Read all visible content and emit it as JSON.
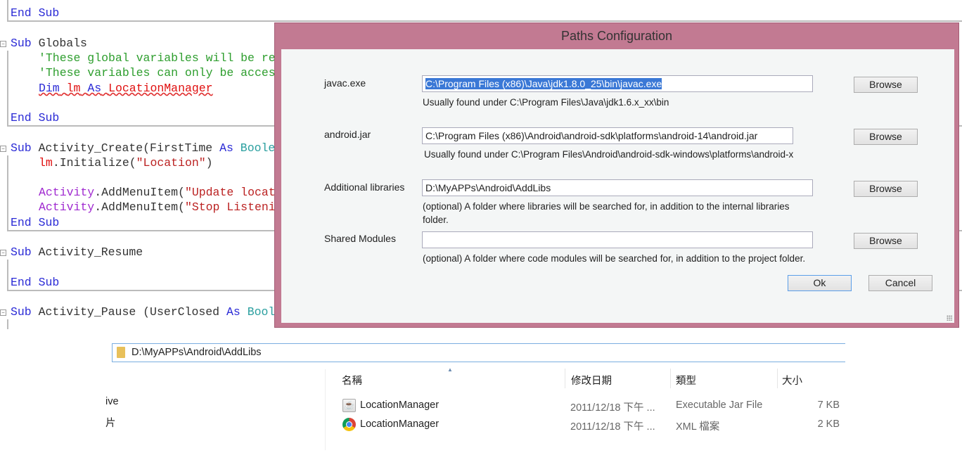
{
  "code": {
    "line0": [
      "End",
      "Sub"
    ],
    "globals": {
      "sub": "Sub",
      "name": "Globals",
      "c1": "'These global variables will be re",
      "c2": "'These variables can only be acces",
      "dim": "Dim",
      "var": "lm",
      "as": "As",
      "type": "LocationManager",
      "end": "End Sub"
    },
    "create": {
      "sub": "Sub",
      "name": "Activity_Create(FirstTime ",
      "as": "As",
      "type": "Boole",
      "l1var": "lm",
      "l1": ".Initialize(",
      "l1str": "\"Location\"",
      "l1end": ")",
      "obj": "Activity",
      "m1": ".AddMenuItem(",
      "s1": "\"Update locat",
      "s2": "\"Stop Listeni",
      "end": "End Sub"
    },
    "resume": {
      "sub": "Sub",
      "name": "Activity_Resume",
      "end": "End Sub"
    },
    "pause": {
      "sub": "Sub",
      "name": "Activity_Pause (UserClosed ",
      "as": "As",
      "type": "Bool"
    }
  },
  "dialog": {
    "title": "Paths Configuration",
    "rows": [
      {
        "label": "javac.exe",
        "value": "C:\\Program Files (x86)\\Java\\jdk1.8.0_25\\bin\\javac.exe",
        "hint": "Usually found under C:\\Program Files\\Java\\jdk1.6.x_xx\\bin",
        "browse": "Browse"
      },
      {
        "label": "android.jar",
        "value": "C:\\Program Files (x86)\\Android\\android-sdk\\platforms\\android-14\\android.jar",
        "hint": "Usually found under C:\\Program Files\\Android\\android-sdk-windows\\platforms\\android-x",
        "browse": "Browse"
      },
      {
        "label": "Additional libraries",
        "value": "D:\\MyAPPs\\Android\\AddLibs",
        "hint": "(optional) A folder where libraries will be searched for, in addition to the internal libraries folder.",
        "browse": "Browse"
      },
      {
        "label": "Shared Modules",
        "value": "",
        "hint": "(optional) A folder where code modules will be searched for, in addition to the project folder.",
        "browse": "Browse"
      }
    ],
    "ok": "Ok",
    "cancel": "Cancel"
  },
  "explorer": {
    "path": "D:\\MyAPPs\\Android\\AddLibs",
    "nav": [
      "ive",
      "片"
    ],
    "columns": [
      "名稱",
      "修改日期",
      "類型",
      "大小"
    ],
    "files": [
      {
        "name": "LocationManager",
        "date": "2011/12/18 下午 ...",
        "type": "Executable Jar File",
        "size": "7 KB",
        "icon": "java-jar-icon"
      },
      {
        "name": "LocationManager",
        "date": "2011/12/18 下午 ...",
        "type": "XML 檔案",
        "size": "2 KB",
        "icon": "chrome-xml-icon"
      }
    ]
  }
}
